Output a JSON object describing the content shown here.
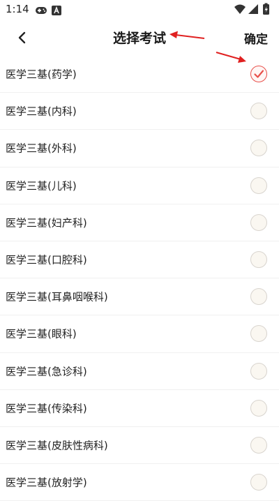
{
  "status": {
    "time": "1:14"
  },
  "header": {
    "title": "选择考试",
    "confirm": "确定"
  },
  "exams": [
    {
      "label": "医学三基(药学)",
      "selected": true
    },
    {
      "label": "医学三基(内科)",
      "selected": false
    },
    {
      "label": "医学三基(外科)",
      "selected": false
    },
    {
      "label": "医学三基(儿科)",
      "selected": false
    },
    {
      "label": "医学三基(妇产科)",
      "selected": false
    },
    {
      "label": "医学三基(口腔科)",
      "selected": false
    },
    {
      "label": "医学三基(耳鼻咽喉科)",
      "selected": false
    },
    {
      "label": "医学三基(眼科)",
      "selected": false
    },
    {
      "label": "医学三基(急诊科)",
      "selected": false
    },
    {
      "label": "医学三基(传染科)",
      "selected": false
    },
    {
      "label": "医学三基(皮肤性病科)",
      "selected": false
    },
    {
      "label": "医学三基(放射学)",
      "selected": false
    }
  ],
  "colors": {
    "accent": "#e8504b",
    "annotation_arrow": "#e02020"
  }
}
